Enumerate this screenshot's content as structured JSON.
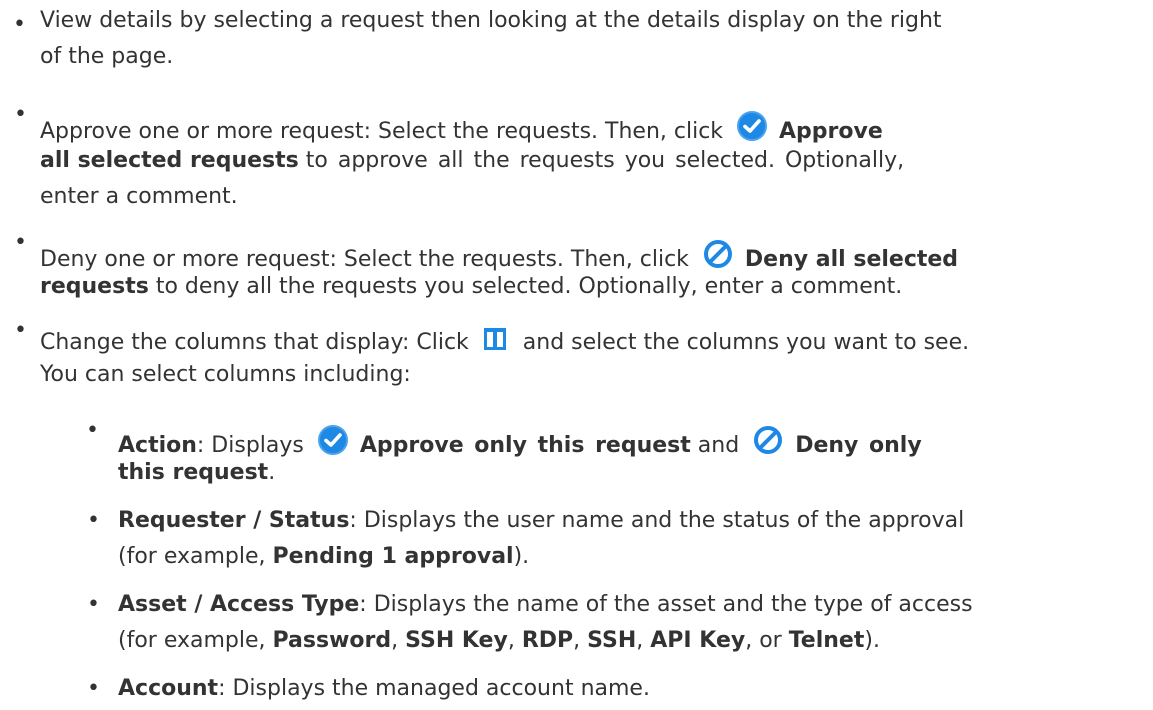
{
  "items": [
    {
      "line1": "View details by selecting a request then looking at the details display on the right",
      "line2": "of the page."
    },
    {
      "l1_pre": "Approve one or more request: Select the requests. Then, click",
      "l1_bold": "Approve",
      "l2_bold": "all selected requests",
      "l2_post": "to approve all the requests you selected. Optionally,",
      "line3": "enter a comment."
    },
    {
      "l1_pre": "Deny one or more request: Select the requests. Then, click",
      "l1_bold": "Deny all selected",
      "l2_bold": "requests",
      "l2_post": "to deny all the requests you selected. Optionally, enter a comment."
    },
    {
      "l1_pre": "Change the columns that display: Click",
      "l1_post": "and select the columns you want to see.",
      "line2": "You can select columns including:"
    }
  ],
  "sub_items": [
    {
      "label": "Action",
      "colon": ": Displays",
      "bold1": "Approve only this request",
      "mid": "and",
      "bold2": "Deny only",
      "l2_bold": "this request",
      "l2_end": "."
    },
    {
      "label": "Requester / Status",
      "text1": ": Displays the user name and the status of the approval",
      "l2_pre": "(for example,",
      "l2_bold": "Pending 1 approval",
      "l2_end": ")."
    },
    {
      "label": "Asset / Access Type",
      "text1": ": Displays the name of the asset and the type of access",
      "l2_pre": "(for example,",
      "types": [
        "Password",
        "SSH Key",
        "RDP",
        "SSH",
        "API Key",
        "Telnet"
      ],
      "sep": ",",
      "or": "or",
      "l2_end": ")."
    },
    {
      "label": "Account",
      "text1": ": Displays the managed account name."
    }
  ],
  "icons": {
    "approve": "check-circle-icon",
    "deny": "deny-circle-icon",
    "columns": "columns-icon"
  },
  "colors": {
    "text": "#333333",
    "approve_blue": "#1e88e5",
    "deny_blue": "#1e88e5"
  }
}
